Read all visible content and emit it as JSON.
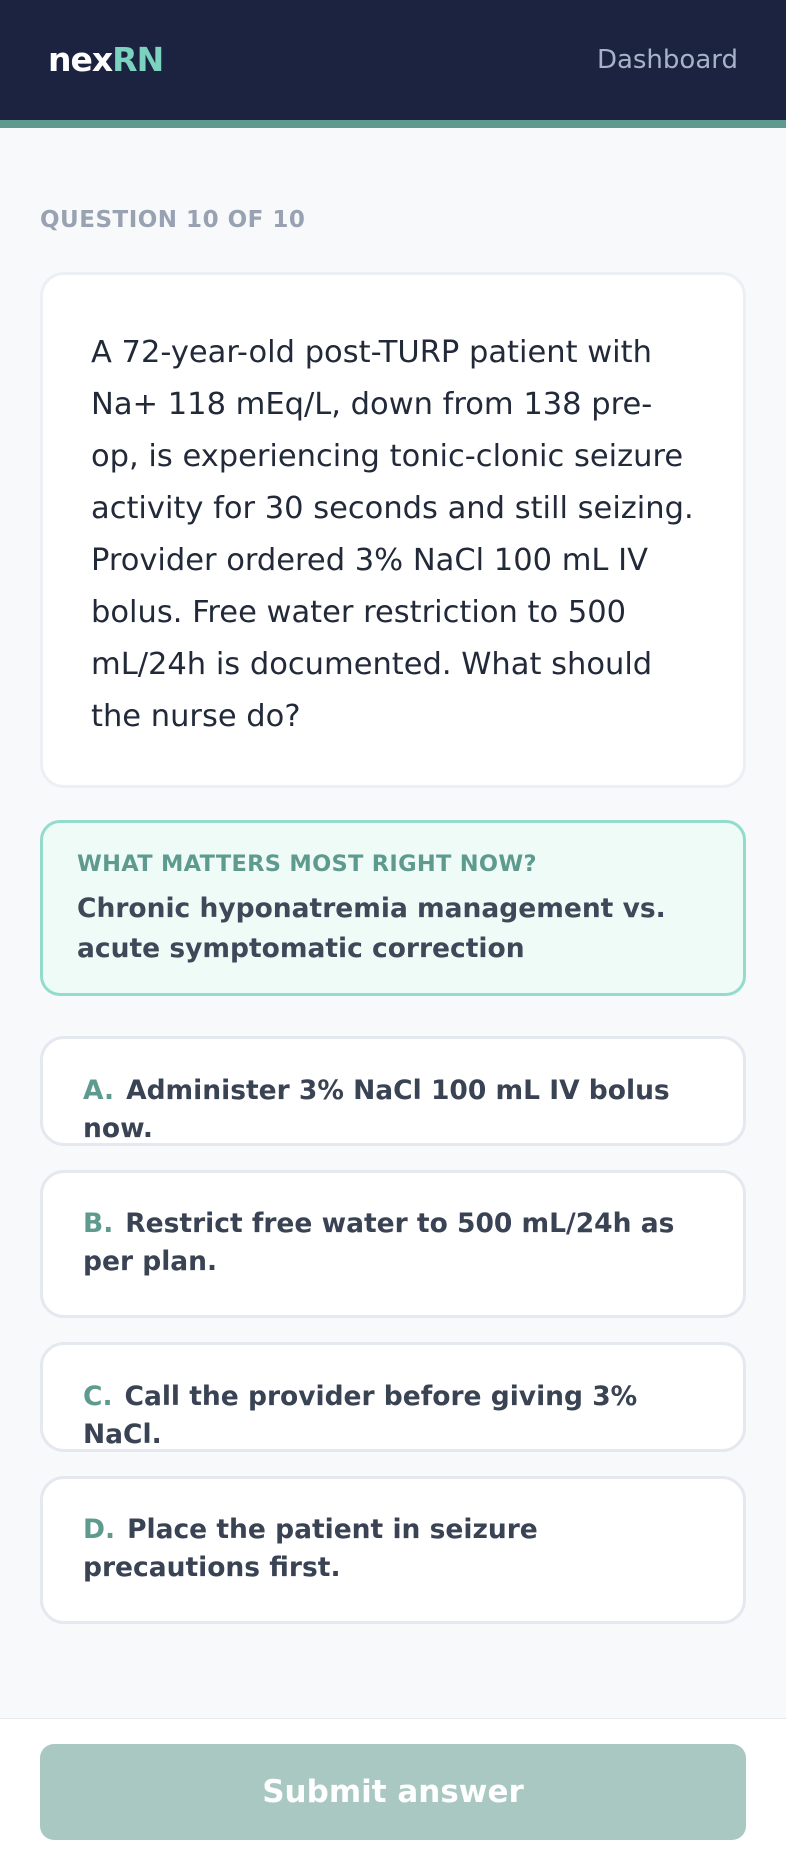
{
  "header": {
    "logo_part1": "nex",
    "logo_part2": "RN",
    "nav_dashboard": "Dashboard"
  },
  "quiz": {
    "progress": "QUESTION 10 OF 10",
    "question": "A 72-year-old post-TURP patient with Na+ 118 mEq/L, down from 138 pre-op, is experiencing tonic-clonic seizure activity for 30 seconds and still seizing. Provider ordered 3% NaCl 100 mL IV bolus. Free water restriction to 500 mL/24h is documented. What should the nurse do?",
    "hint": {
      "title": "WHAT MATTERS MOST RIGHT NOW?",
      "text": "Chronic hyponatremia management vs. acute symptomatic correction"
    },
    "options": [
      {
        "letter": "A.",
        "text": "Administer 3% NaCl 100 mL IV bolus now."
      },
      {
        "letter": "B.",
        "text": "Restrict free water to 500 mL/24h as per plan."
      },
      {
        "letter": "C.",
        "text": "Call the provider before giving 3% NaCl."
      },
      {
        "letter": "D.",
        "text": "Place the patient in seizure precautions first."
      }
    ]
  },
  "footer": {
    "submit_label": "Submit answer"
  },
  "colors": {
    "header_bg": "#1b2341",
    "accent": "#5e9b8e",
    "accent_light": "#7ad2bf",
    "submit_disabled": "#a8c8c1"
  }
}
